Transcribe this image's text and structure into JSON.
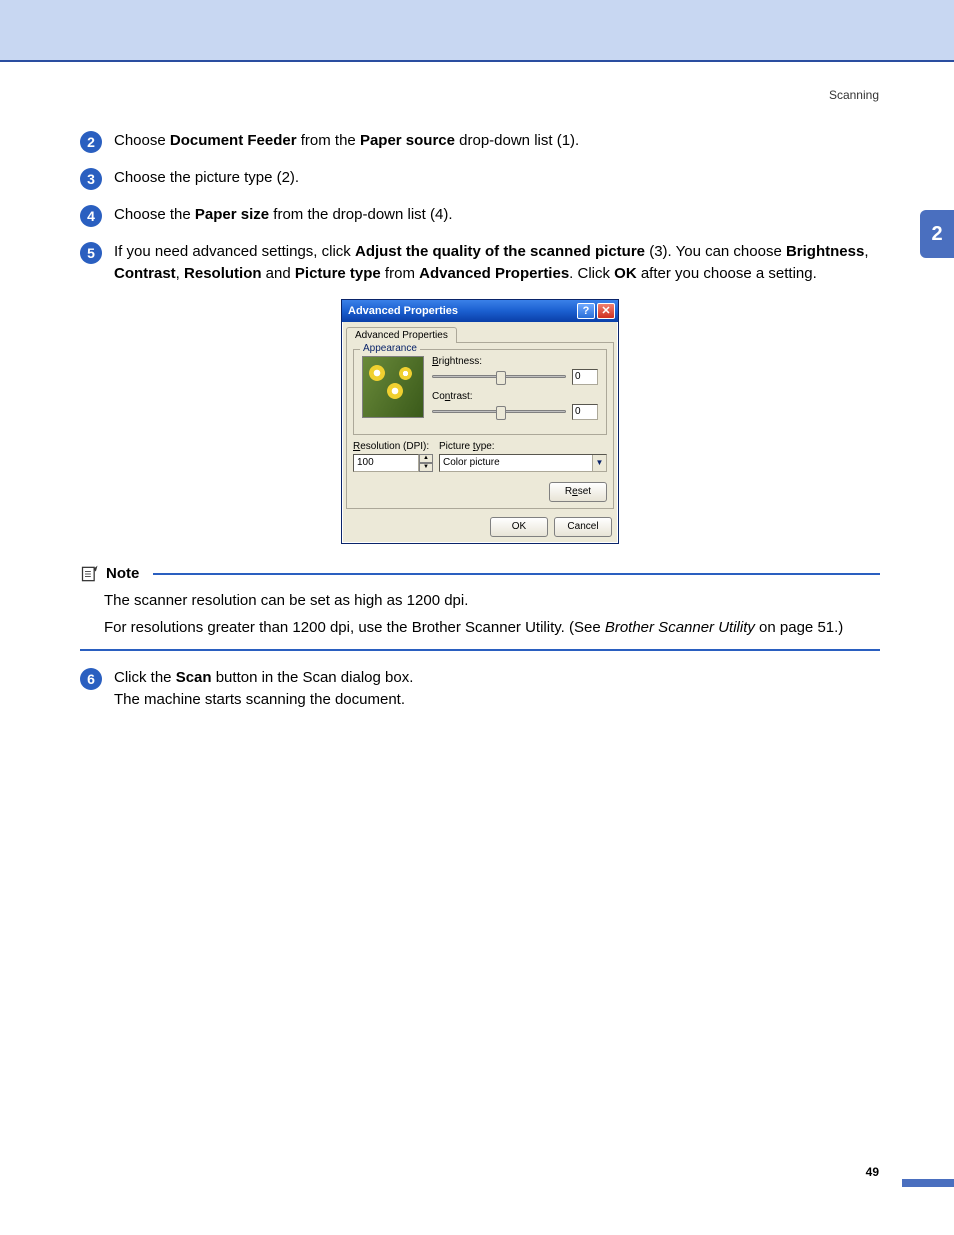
{
  "header": {
    "section": "Scanning"
  },
  "sideTab": "2",
  "steps": {
    "s2": {
      "num": "2",
      "pre": "Choose ",
      "b1": "Document Feeder",
      "mid": " from the ",
      "b2": "Paper source",
      "post": " drop-down list (1)."
    },
    "s3": {
      "num": "3",
      "text": "Choose the picture type (2)."
    },
    "s4": {
      "num": "4",
      "pre": "Choose the ",
      "b1": "Paper size",
      "post": " from the drop-down list (4)."
    },
    "s5": {
      "num": "5",
      "pre": "If you need advanced settings, click ",
      "b1": "Adjust the quality of the scanned picture",
      "mid1": " (3). You can choose ",
      "b2": "Brightness",
      "c1": ", ",
      "b3": "Contrast",
      "c2": ", ",
      "b4": "Resolution",
      "c3": " and ",
      "b5": "Picture type",
      "mid2": " from ",
      "b6": "Advanced Properties",
      "mid3": ". Click ",
      "b7": "OK",
      "post": " after you choose a setting."
    },
    "s6": {
      "num": "6",
      "pre": "Click the ",
      "b1": "Scan",
      "post": " button in the Scan dialog box.",
      "line2": "The machine starts scanning the document."
    }
  },
  "dialog": {
    "title": "Advanced Properties",
    "tab": "Advanced Properties",
    "group": "Appearance",
    "brightnessLabel": "Brightness:",
    "brightnessVal": "0",
    "contrastLabel": "Contrast:",
    "contrastVal": "0",
    "resolutionLabel": "Resolution (DPI):",
    "resolutionVal": "100",
    "pictureTypeLabel": "Picture type:",
    "pictureTypeVal": "Color picture",
    "reset": "Reset",
    "ok": "OK",
    "cancel": "Cancel",
    "help": "?",
    "close": "✕"
  },
  "note": {
    "title": "Note",
    "p1": "The scanner resolution can be set as high as 1200 dpi.",
    "p2a": "For resolutions greater than 1200 dpi, use the Brother Scanner Utility. (See ",
    "p2i": "Brother Scanner Utility",
    "p2b": " on page 51.)"
  },
  "pageNumber": "49"
}
